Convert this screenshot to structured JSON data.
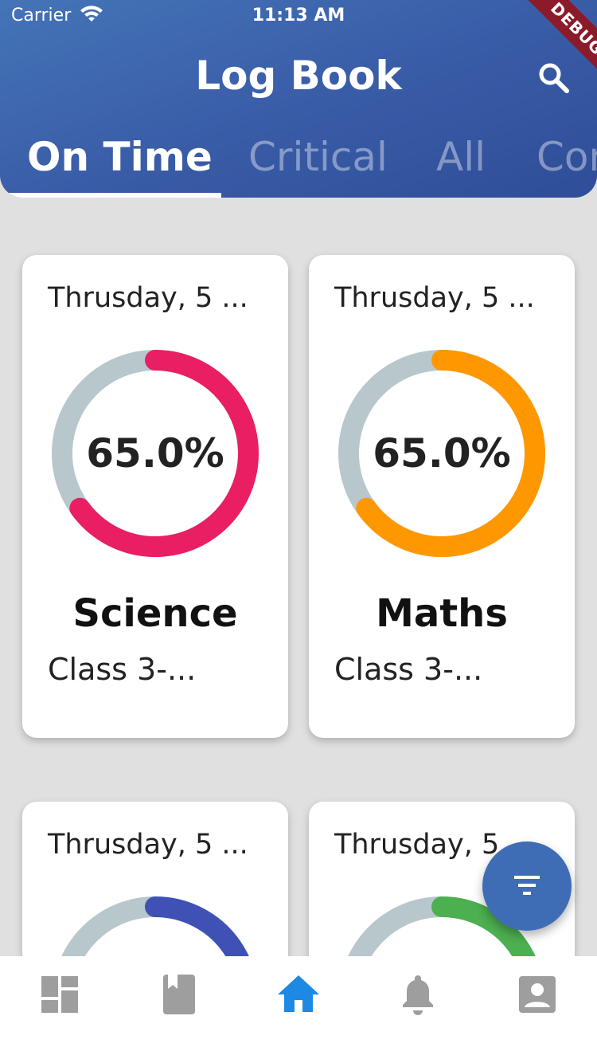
{
  "status": {
    "carrier": "Carrier",
    "time": "11:13 AM"
  },
  "appbar": {
    "title": "Log Book",
    "debug_label": "DEBUG"
  },
  "tabs": [
    {
      "label": "On Time",
      "active": true
    },
    {
      "label": "Critical",
      "active": false
    },
    {
      "label": "All",
      "active": false
    },
    {
      "label": "Con",
      "active": false
    }
  ],
  "cards": [
    {
      "date": "Thrusday, 5 ...",
      "percent_label": "65.0%",
      "percent": 65.0,
      "subject": "Science",
      "class": "Class 3-...",
      "color": "#e91e63"
    },
    {
      "date": "Thrusday, 5 ...",
      "percent_label": "65.0%",
      "percent": 65.0,
      "subject": "Maths",
      "class": "Class 3-...",
      "color": "#ff9800"
    },
    {
      "date": "Thrusday, 5 ...",
      "percent_label": "",
      "percent": 65.0,
      "subject": "",
      "class": "",
      "color": "#3f51b5"
    },
    {
      "date": "Thrusday, 5",
      "percent_label": "",
      "percent": 65.0,
      "subject": "",
      "class": "",
      "color": "#4caf50"
    }
  ],
  "colors": {
    "track": "#b8c7cc",
    "accent": "#3f6db5",
    "nav_active": "#1e88e5",
    "nav_inactive": "#9e9e9e"
  },
  "bottom_nav": [
    {
      "icon": "dashboard-icon",
      "active": false
    },
    {
      "icon": "book-icon",
      "active": false
    },
    {
      "icon": "home-icon",
      "active": true
    },
    {
      "icon": "bell-icon",
      "active": false
    },
    {
      "icon": "profile-icon",
      "active": false
    }
  ],
  "fab": {
    "icon": "filter-icon"
  }
}
